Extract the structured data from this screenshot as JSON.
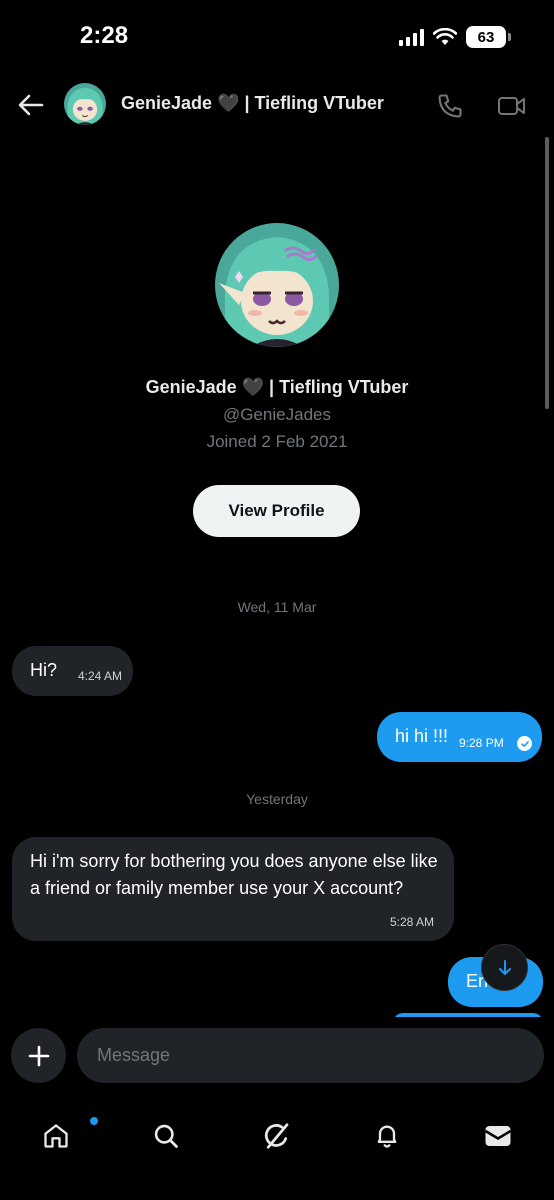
{
  "status_bar": {
    "time": "2:28",
    "battery": "63"
  },
  "header": {
    "name": "GenieJade 🖤 | Tiefling VTuber"
  },
  "profile": {
    "name": "GenieJade 🖤 | Tiefling VTuber",
    "handle": "@GenieJades",
    "joined": "Joined 2 Feb 2021",
    "view_profile_label": "View Profile"
  },
  "conversation": {
    "separators": [
      "Wed, 11 Mar",
      "Yesterday"
    ],
    "messages": [
      {
        "direction": "incoming",
        "text": "Hi?",
        "time": "4:24 AM"
      },
      {
        "direction": "outgoing",
        "text": "hi hi !!!",
        "time": "9:28 PM",
        "status": "seen"
      },
      {
        "direction": "incoming",
        "text": "Hi i'm sorry for bothering you does anyone else like a friend or family member use your X account?",
        "time": "5:28 AM"
      },
      {
        "direction": "outgoing",
        "text": "Erm"
      }
    ]
  },
  "composer": {
    "placeholder": "Message"
  },
  "nav": {
    "items": [
      "home-icon",
      "search-icon",
      "grok-icon",
      "bell-icon",
      "mail-icon"
    ],
    "badge_on": "home-icon"
  },
  "colors": {
    "background": "#000000",
    "accent": "#1d9bf0",
    "incoming_bubble": "#202327",
    "muted_text": "#71767b"
  }
}
